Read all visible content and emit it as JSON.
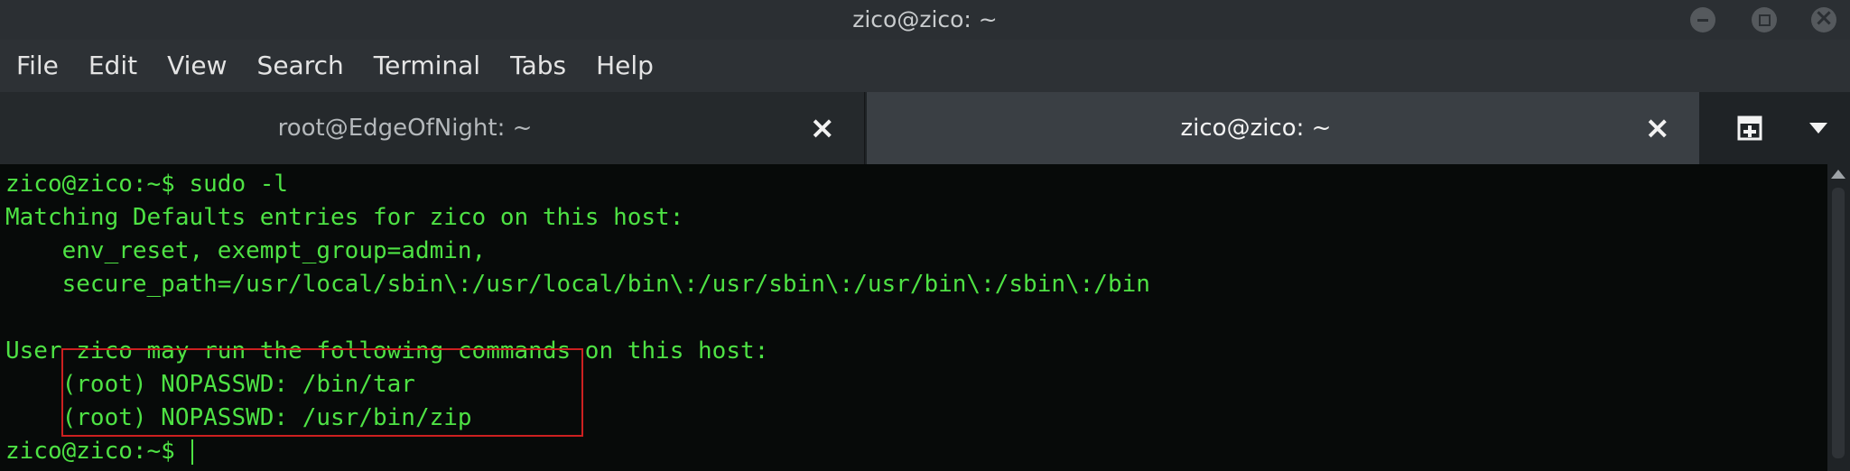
{
  "window": {
    "title": "zico@zico: ~"
  },
  "menubar": {
    "items": [
      "File",
      "Edit",
      "View",
      "Search",
      "Terminal",
      "Tabs",
      "Help"
    ]
  },
  "tabs": [
    {
      "label": "root@EdgeOfNight: ~",
      "active": false
    },
    {
      "label": "zico@zico: ~",
      "active": true
    }
  ],
  "icons": {
    "tab_close": "×",
    "new_tab": "new-tab-icon",
    "tab_menu": "chevron-down-icon"
  },
  "terminal": {
    "text_color": "#4ee244",
    "background": "#070a09",
    "lines": [
      "zico@zico:~$ sudo -l",
      "Matching Defaults entries for zico on this host:",
      "    env_reset, exempt_group=admin,",
      "    secure_path=/usr/local/sbin\\:/usr/local/bin\\:/usr/sbin\\:/usr/bin\\:/sbin\\:/bin",
      "",
      "User zico may run the following commands on this host:",
      "    (root) NOPASSWD: /bin/tar",
      "    (root) NOPASSWD: /usr/bin/zip",
      "zico@zico:~$ "
    ],
    "highlight_color": "#cc2020"
  }
}
